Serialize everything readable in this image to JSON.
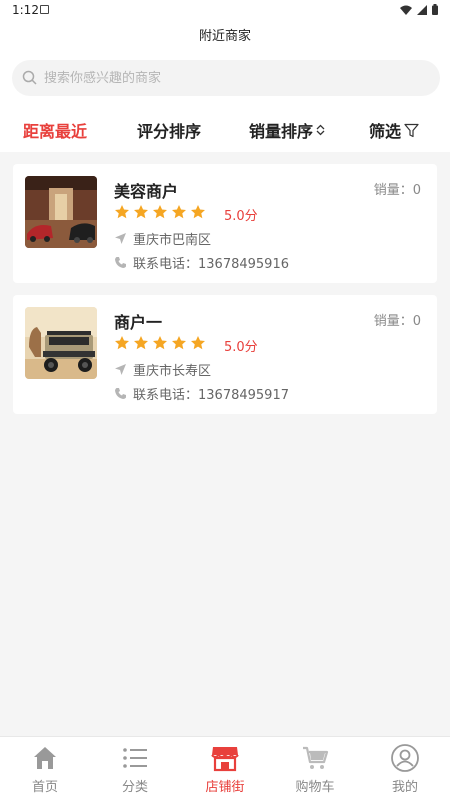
{
  "status_bar": {
    "time": "1:12"
  },
  "header": {
    "title": "附近商家"
  },
  "search": {
    "placeholder": "搜索你感兴趣的商家"
  },
  "sort_tabs": [
    {
      "label": "距离最近",
      "active": true
    },
    {
      "label": "评分排序",
      "active": false
    },
    {
      "label": "销量排序",
      "active": false
    },
    {
      "label": "筛选",
      "active": false
    }
  ],
  "merchants": [
    {
      "name": "美容商户",
      "sales": "销量：0",
      "rating": "5.0分",
      "stars": 5,
      "address": "重庆市巴南区",
      "phone": "联系电话：13678495916"
    },
    {
      "name": "商户一",
      "sales": "销量：0",
      "rating": "5.0分",
      "stars": 5,
      "address": "重庆市长寿区",
      "phone": "联系电话：13678495917"
    }
  ],
  "tabbar": [
    {
      "label": "首页",
      "icon": "home-icon"
    },
    {
      "label": "分类",
      "icon": "list-icon"
    },
    {
      "label": "店铺街",
      "icon": "store-icon",
      "active": true
    },
    {
      "label": "购物车",
      "icon": "cart-icon"
    },
    {
      "label": "我的",
      "icon": "user-icon"
    }
  ],
  "colors": {
    "accent": "#e8403c",
    "star": "#f5a623"
  }
}
